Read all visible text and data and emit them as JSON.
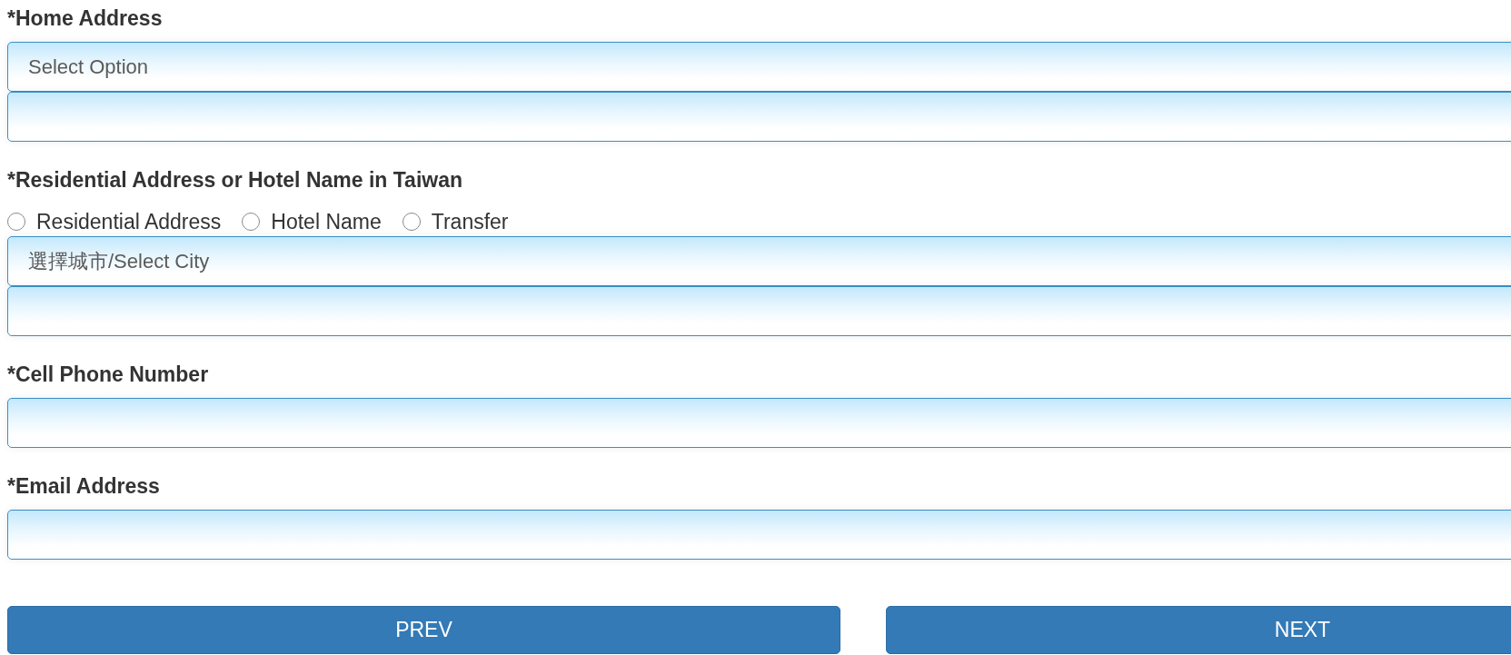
{
  "sections": [
    {
      "label": "*Home Address",
      "fields": [
        {
          "kind": "select",
          "placeholder": "Select Option"
        },
        {
          "kind": "text"
        }
      ]
    },
    {
      "label": "*Residential Address or Hotel Name in Taiwan",
      "options": [
        {
          "label": "Residential Address",
          "selected": false
        },
        {
          "label": "Hotel Name",
          "selected": false
        },
        {
          "label": "Transfer",
          "selected": false
        }
      ],
      "fields": [
        {
          "kind": "select",
          "placeholder": "選擇城市/Select City"
        },
        {
          "kind": "text"
        }
      ]
    },
    {
      "label": "*Cell Phone Number",
      "fields": [
        {
          "kind": "text"
        }
      ]
    },
    {
      "label": "*Email Address",
      "fields": [
        {
          "kind": "text"
        }
      ]
    }
  ],
  "buttons": [
    {
      "label": "PREV"
    },
    {
      "label": "NEXT"
    }
  ]
}
